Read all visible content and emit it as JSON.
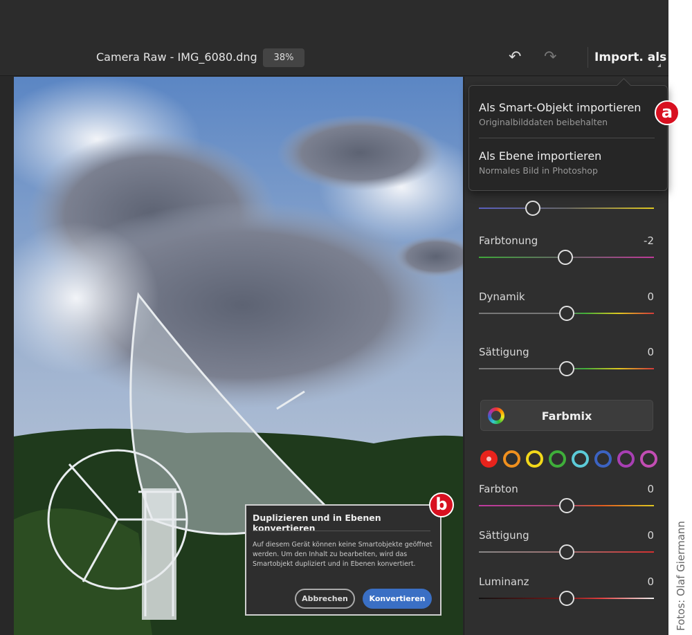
{
  "header": {
    "title": "Camera Raw - IMG_6080.dng",
    "zoom": "38%",
    "import_label": "Import. als"
  },
  "import_menu": {
    "items": [
      {
        "title": "Als Smart-Objekt importieren",
        "subtitle": "Originalbilddaten beibehalten"
      },
      {
        "title": "Als Ebene importieren",
        "subtitle": "Normales Bild in Photoshop"
      }
    ]
  },
  "annotations": {
    "a": "a",
    "b": "b"
  },
  "panel": {
    "temp_slider": {
      "position": 0.31
    },
    "sliders": [
      {
        "label": "Farbtonung",
        "value": "-2",
        "position": 0.496
      },
      {
        "label": "Dynamik",
        "value": "0",
        "position": 0.5
      },
      {
        "label": "Sättigung",
        "value": "0",
        "position": 0.5
      }
    ],
    "farbmix_label": "Farbmix",
    "colors": [
      "#e8231c",
      "#f0901e",
      "#f2d81a",
      "#3fae3a",
      "#5ccbd8",
      "#3c63c2",
      "#a83fb3",
      "#c24db3"
    ],
    "mix_sliders": [
      {
        "label": "Farbton",
        "value": "0",
        "position": 0.5
      },
      {
        "label": "Sättigung",
        "value": "0",
        "position": 0.5
      },
      {
        "label": "Luminanz",
        "value": "0",
        "position": 0.5
      }
    ]
  },
  "dialog": {
    "title": "Duplizieren und in Ebenen konvertieren",
    "body": "Auf diesem Gerät können keine Smartobjekte geöffnet werden. Um den Inhalt zu bearbeiten, wird das Smartobjekt dupliziert und in Ebenen konvertiert.",
    "cancel_label": "Abbrechen",
    "confirm_label": "Konvertieren"
  },
  "credit": "Fotos: Olaf Giermann"
}
